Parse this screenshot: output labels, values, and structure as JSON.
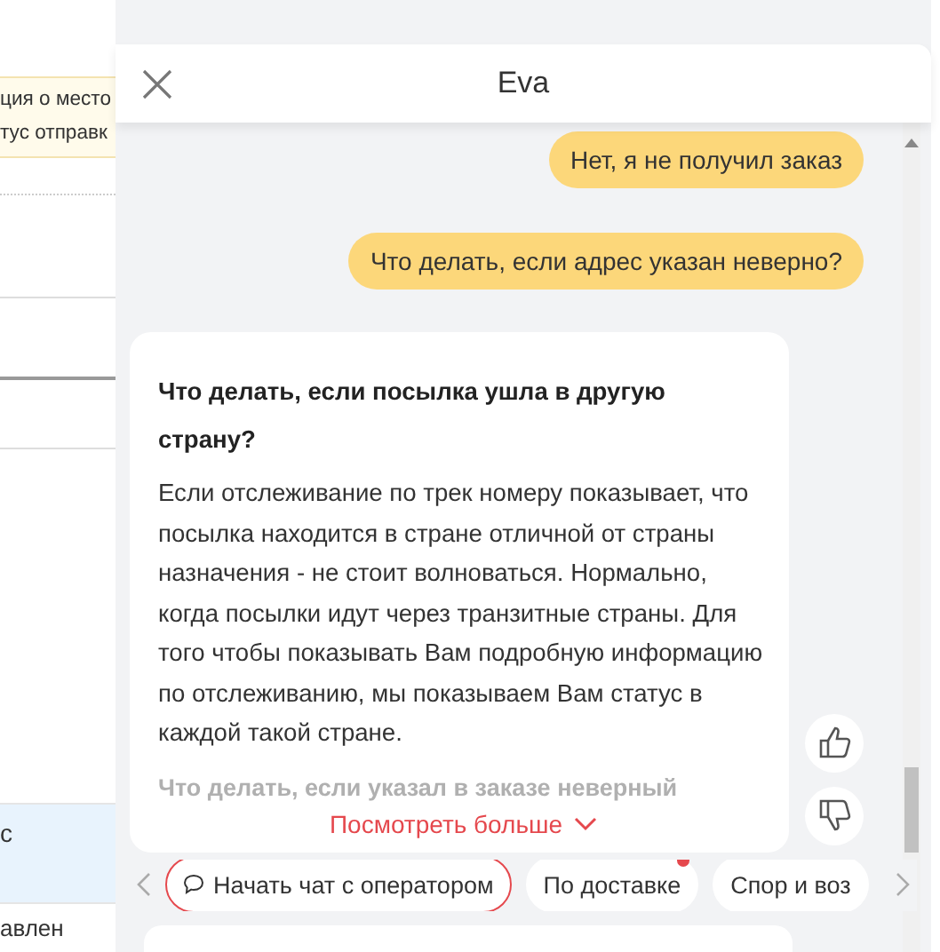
{
  "background_page": {
    "notice_lines": [
      "ция о место",
      "тус отправк"
    ],
    "rows": [
      {
        "text": "с",
        "selected": true
      },
      {
        "text": "авлен",
        "selected": false
      }
    ]
  },
  "chat": {
    "title": "Eva",
    "messages": [
      {
        "kind": "user",
        "text": "Нет, я не получил заказ"
      },
      {
        "kind": "user",
        "text": "Что делать, если адрес указан неверно?"
      },
      {
        "kind": "bot",
        "title": "Что делать, если посылка ушла в другую страну?",
        "body": "Если отслеживание по трек номеру показывает, что посылка находится в стране отличной от страны назначения - не стоит волноваться. Нормально, когда посылки идут через транзитные страны. Для того чтобы показывать Вам подробную информацию по отслеживанию, мы показываем Вам статус в каждой такой стране.",
        "faded_text": "Что делать, если указал в заказе неверный",
        "more_link": "Посмотреть больше"
      }
    ],
    "chips": [
      {
        "kind": "operator",
        "label": "Начать чат с оператором",
        "notification": false
      },
      {
        "kind": "topic",
        "label": "По доставке",
        "notification": true
      },
      {
        "kind": "topic",
        "label": "Спор и воз",
        "notification": false
      }
    ]
  }
}
